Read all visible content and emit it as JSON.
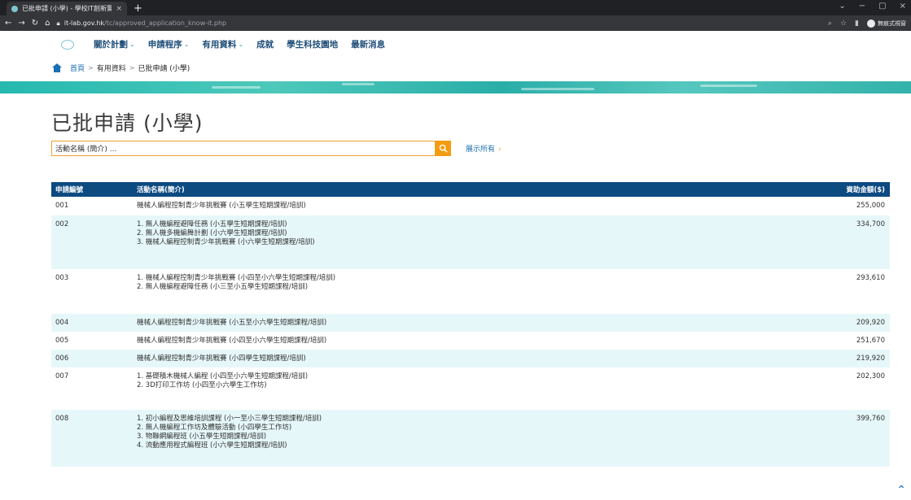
{
  "browser": {
    "tab_title": "已批申請 (小學) - 學校IT創新實驗室",
    "tab_close": "×",
    "new_tab": "+",
    "url_host": "it-lab.gov.hk",
    "url_path": "/tc/approved_application_know-it.php",
    "incognito_label": "無痕式視窗",
    "win_min": "−",
    "win_max": "▢",
    "win_close": "×"
  },
  "nav": {
    "items": [
      {
        "label": "關於計劃",
        "has_dropdown": true
      },
      {
        "label": "申請程序",
        "has_dropdown": true
      },
      {
        "label": "有用資料",
        "has_dropdown": true
      },
      {
        "label": "成就",
        "has_dropdown": false
      },
      {
        "label": "學生科技園地",
        "has_dropdown": false
      },
      {
        "label": "最新消息",
        "has_dropdown": false
      }
    ],
    "chevron": "⌄"
  },
  "breadcrumb": {
    "home": "首頁",
    "sep": ">",
    "level1": "有用資料",
    "current": "已批申請 (小學)"
  },
  "page": {
    "title": "已批申請 (小學)",
    "search_value": "活動名稱 (簡介) ...",
    "show_all": "展示所有",
    "show_all_arrow": "›"
  },
  "table": {
    "headers": {
      "id": "申請編號",
      "activity": "活動名稱(簡介)",
      "amount": "資助金額($)"
    },
    "rows": [
      {
        "id": "001",
        "amount": "255,000",
        "height": 23,
        "lines": [
          "機械人編程控制青少年挑戰賽 (小五學生短期課程/培訓)"
        ]
      },
      {
        "id": "002",
        "amount": "334,700",
        "height": 66,
        "lines": [
          "1. 無人機編程避障任務 (小五學生短期課程/培訓)",
          "2. 無人機多機編舞計劃 (小六學生短期課程/培訓)",
          "3. 機械人編程控制青少年挑戰賽 (小六學生短期課程/培訓)"
        ]
      },
      {
        "id": "003",
        "amount": "293,610",
        "height": 55,
        "lines": [
          "1. 機械人編程控制青少年挑戰賽 (小四至小六學生短期課程/培訓)",
          "2. 無人機編程避障任務 (小三至小五學生短期課程/培訓)"
        ]
      },
      {
        "id": "004",
        "amount": "209,920",
        "height": 22,
        "lines": [
          "機械人編程控制青少年挑戰賽 (小五至小六學生短期課程/培訓)"
        ]
      },
      {
        "id": "005",
        "amount": "251,670",
        "height": 22,
        "lines": [
          "機械人編程控制青少年挑戰賽 (小四至小六學生短期課程/培訓)"
        ]
      },
      {
        "id": "006",
        "amount": "219,920",
        "height": 22,
        "lines": [
          "機械人編程控制青少年挑戰賽 (小四學生短期課程/培訓)"
        ]
      },
      {
        "id": "007",
        "amount": "202,300",
        "height": 52,
        "lines": [
          "1. 基礎積木機械人編程 (小四至小六學生短期課程/培訓)",
          "2. 3D打印工作坊 (小四至小六學生工作坊)"
        ]
      },
      {
        "id": "008",
        "amount": "399,760",
        "height": 70,
        "lines": [
          "1. 初小編程及思維培訓課程 (小一至小三學生短期課程/培訓)",
          "2. 無人機編程工作坊及體驗活動 (小四學生工作坊)",
          "3. 物聯網編程班 (小五學生短期課程/培訓)",
          "4. 流動應用程式編程班 (小六學生短期課程/培訓)"
        ]
      }
    ]
  },
  "scroll_top": "⌃"
}
